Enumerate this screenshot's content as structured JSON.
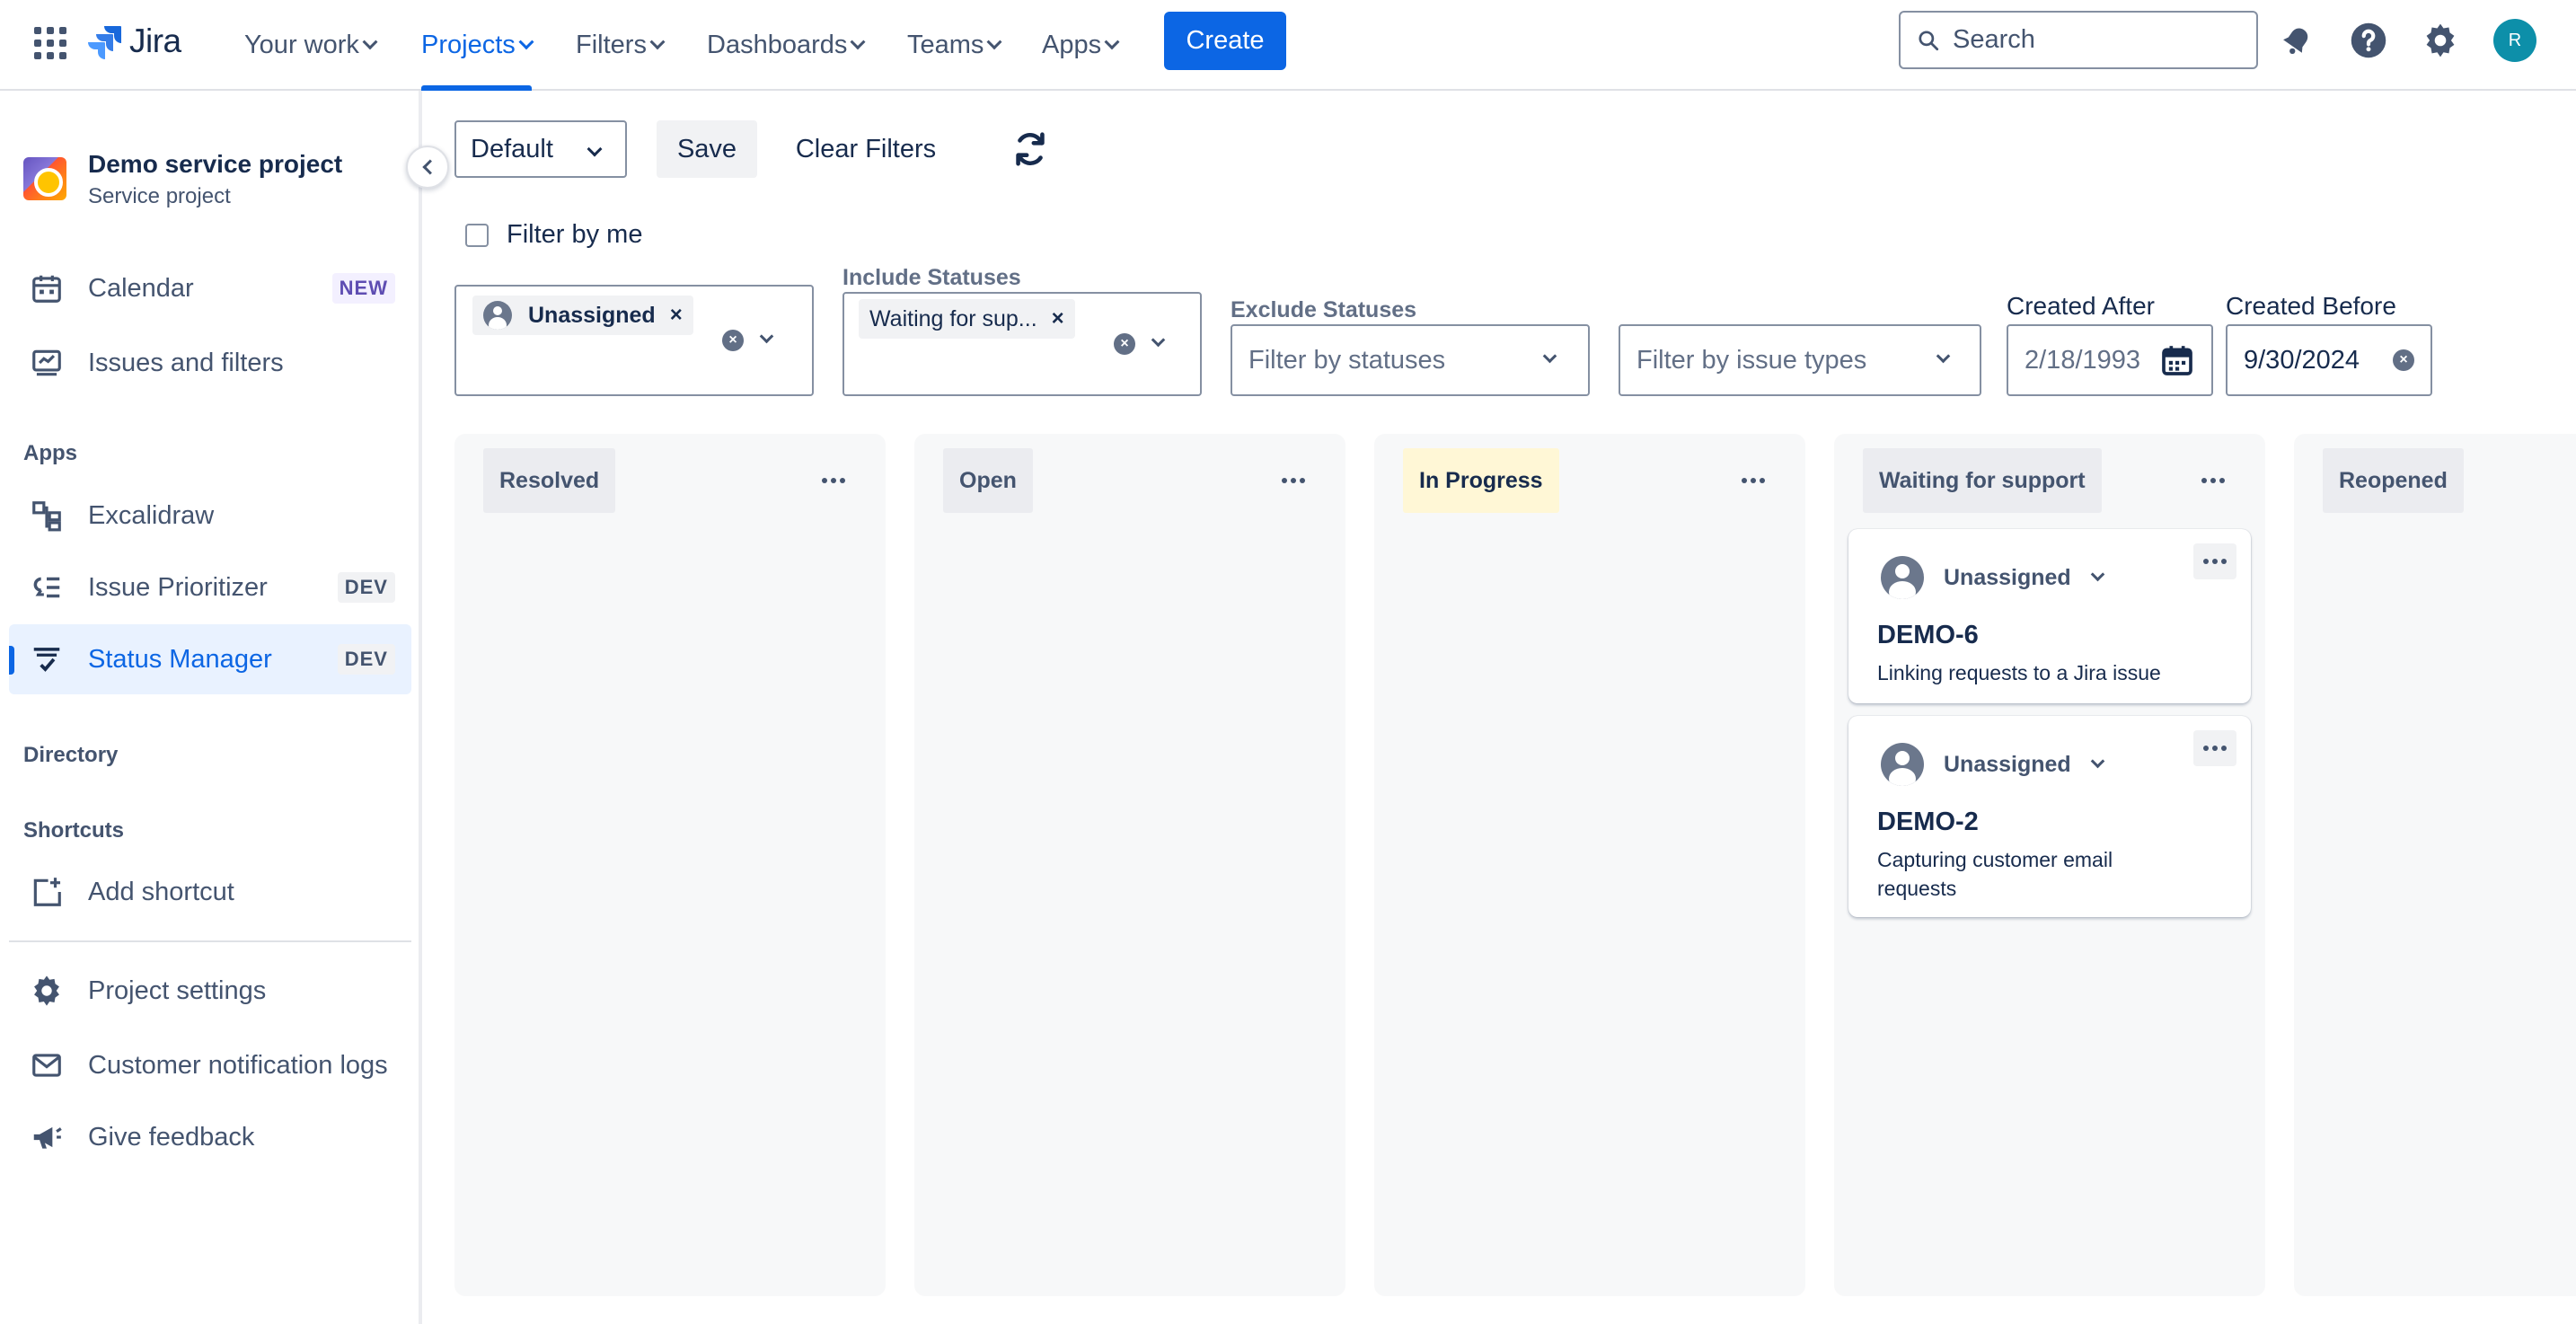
{
  "topnav": {
    "logo_text": "Jira",
    "items": [
      {
        "label": "Your work"
      },
      {
        "label": "Projects"
      },
      {
        "label": "Filters"
      },
      {
        "label": "Dashboards"
      },
      {
        "label": "Teams"
      },
      {
        "label": "Apps"
      }
    ],
    "create_label": "Create",
    "search_placeholder": "Search",
    "avatar_initial": "R",
    "accent": "#0c66e4"
  },
  "sidebar": {
    "project_name": "Demo service project",
    "project_type": "Service project",
    "items": [
      {
        "label": "Calendar",
        "badge": "NEW",
        "icon": "calendar-icon"
      },
      {
        "label": "Issues and filters",
        "icon": "issues-icon"
      },
      {
        "label": "Excalidraw",
        "icon": "excalidraw-icon"
      },
      {
        "label": "Issue Prioritizer",
        "badge": "DEV",
        "icon": "prioritizer-icon"
      },
      {
        "label": "Status Manager",
        "badge": "DEV",
        "icon": "status-manager-icon"
      },
      {
        "label": "Add shortcut",
        "icon": "add-shortcut-icon"
      },
      {
        "label": "Project settings",
        "icon": "gear-icon"
      },
      {
        "label": "Customer notification logs",
        "icon": "mail-icon"
      },
      {
        "label": "Give feedback",
        "icon": "megaphone-icon"
      }
    ],
    "sections": {
      "apps": "Apps",
      "directory": "Directory",
      "shortcuts": "Shortcuts"
    }
  },
  "toolbar": {
    "view_select": "Default",
    "save_label": "Save",
    "clear_label": "Clear Filters",
    "filter_by_me": "Filter by me"
  },
  "filters": {
    "assignee_chip": "Unassigned",
    "include_label": "Include Statuses",
    "include_chip": "Waiting for sup...",
    "exclude_label": "Exclude Statuses",
    "exclude_placeholder": "Filter by statuses",
    "issue_types_placeholder": "Filter by issue types",
    "created_after_label": "Created After",
    "created_after_value": "2/18/1993",
    "created_before_label": "Created Before",
    "created_before_value": "9/30/2024"
  },
  "board": {
    "columns": [
      {
        "name": "Resolved"
      },
      {
        "name": "Open"
      },
      {
        "name": "In Progress"
      },
      {
        "name": "Waiting for support"
      },
      {
        "name": "Reopened"
      }
    ],
    "cards": [
      {
        "assignee": "Unassigned",
        "key": "DEMO-6",
        "summary": "Linking requests to a Jira issue"
      },
      {
        "assignee": "Unassigned",
        "key": "DEMO-2",
        "summary": "Capturing customer email requests"
      }
    ]
  }
}
